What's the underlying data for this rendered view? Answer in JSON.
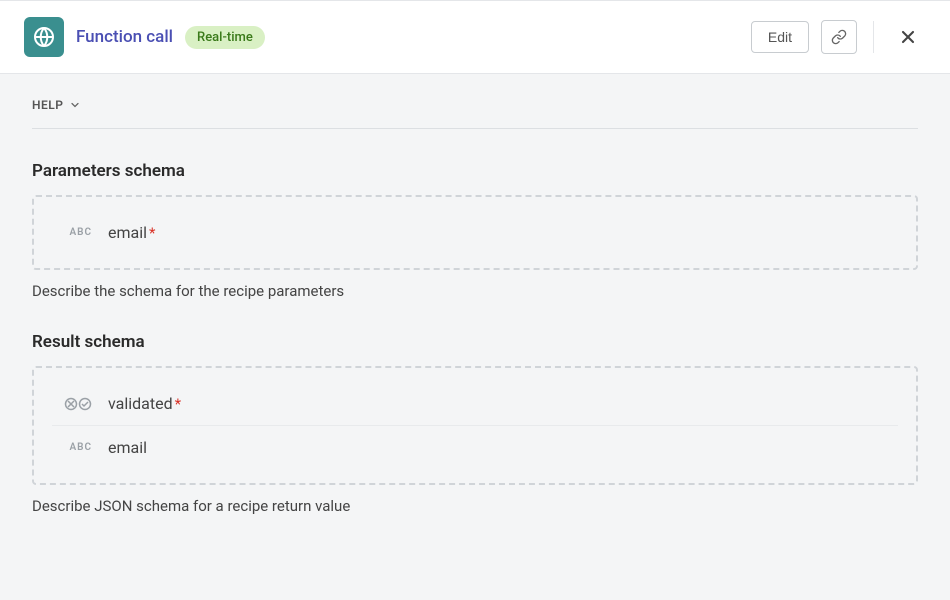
{
  "header": {
    "title": "Function call",
    "badge": "Real-time",
    "edit_label": "Edit"
  },
  "help": {
    "label": "HELP"
  },
  "sections": {
    "parameters": {
      "title": "Parameters schema",
      "help": "Describe the schema for the recipe parameters",
      "fields": [
        {
          "name": "email",
          "type": "ABC",
          "required": true
        }
      ]
    },
    "result": {
      "title": "Result schema",
      "help": "Describe JSON schema for a recipe return value",
      "fields": [
        {
          "name": "validated",
          "type": "boolean",
          "required": true
        },
        {
          "name": "email",
          "type": "ABC",
          "required": false
        }
      ]
    }
  }
}
